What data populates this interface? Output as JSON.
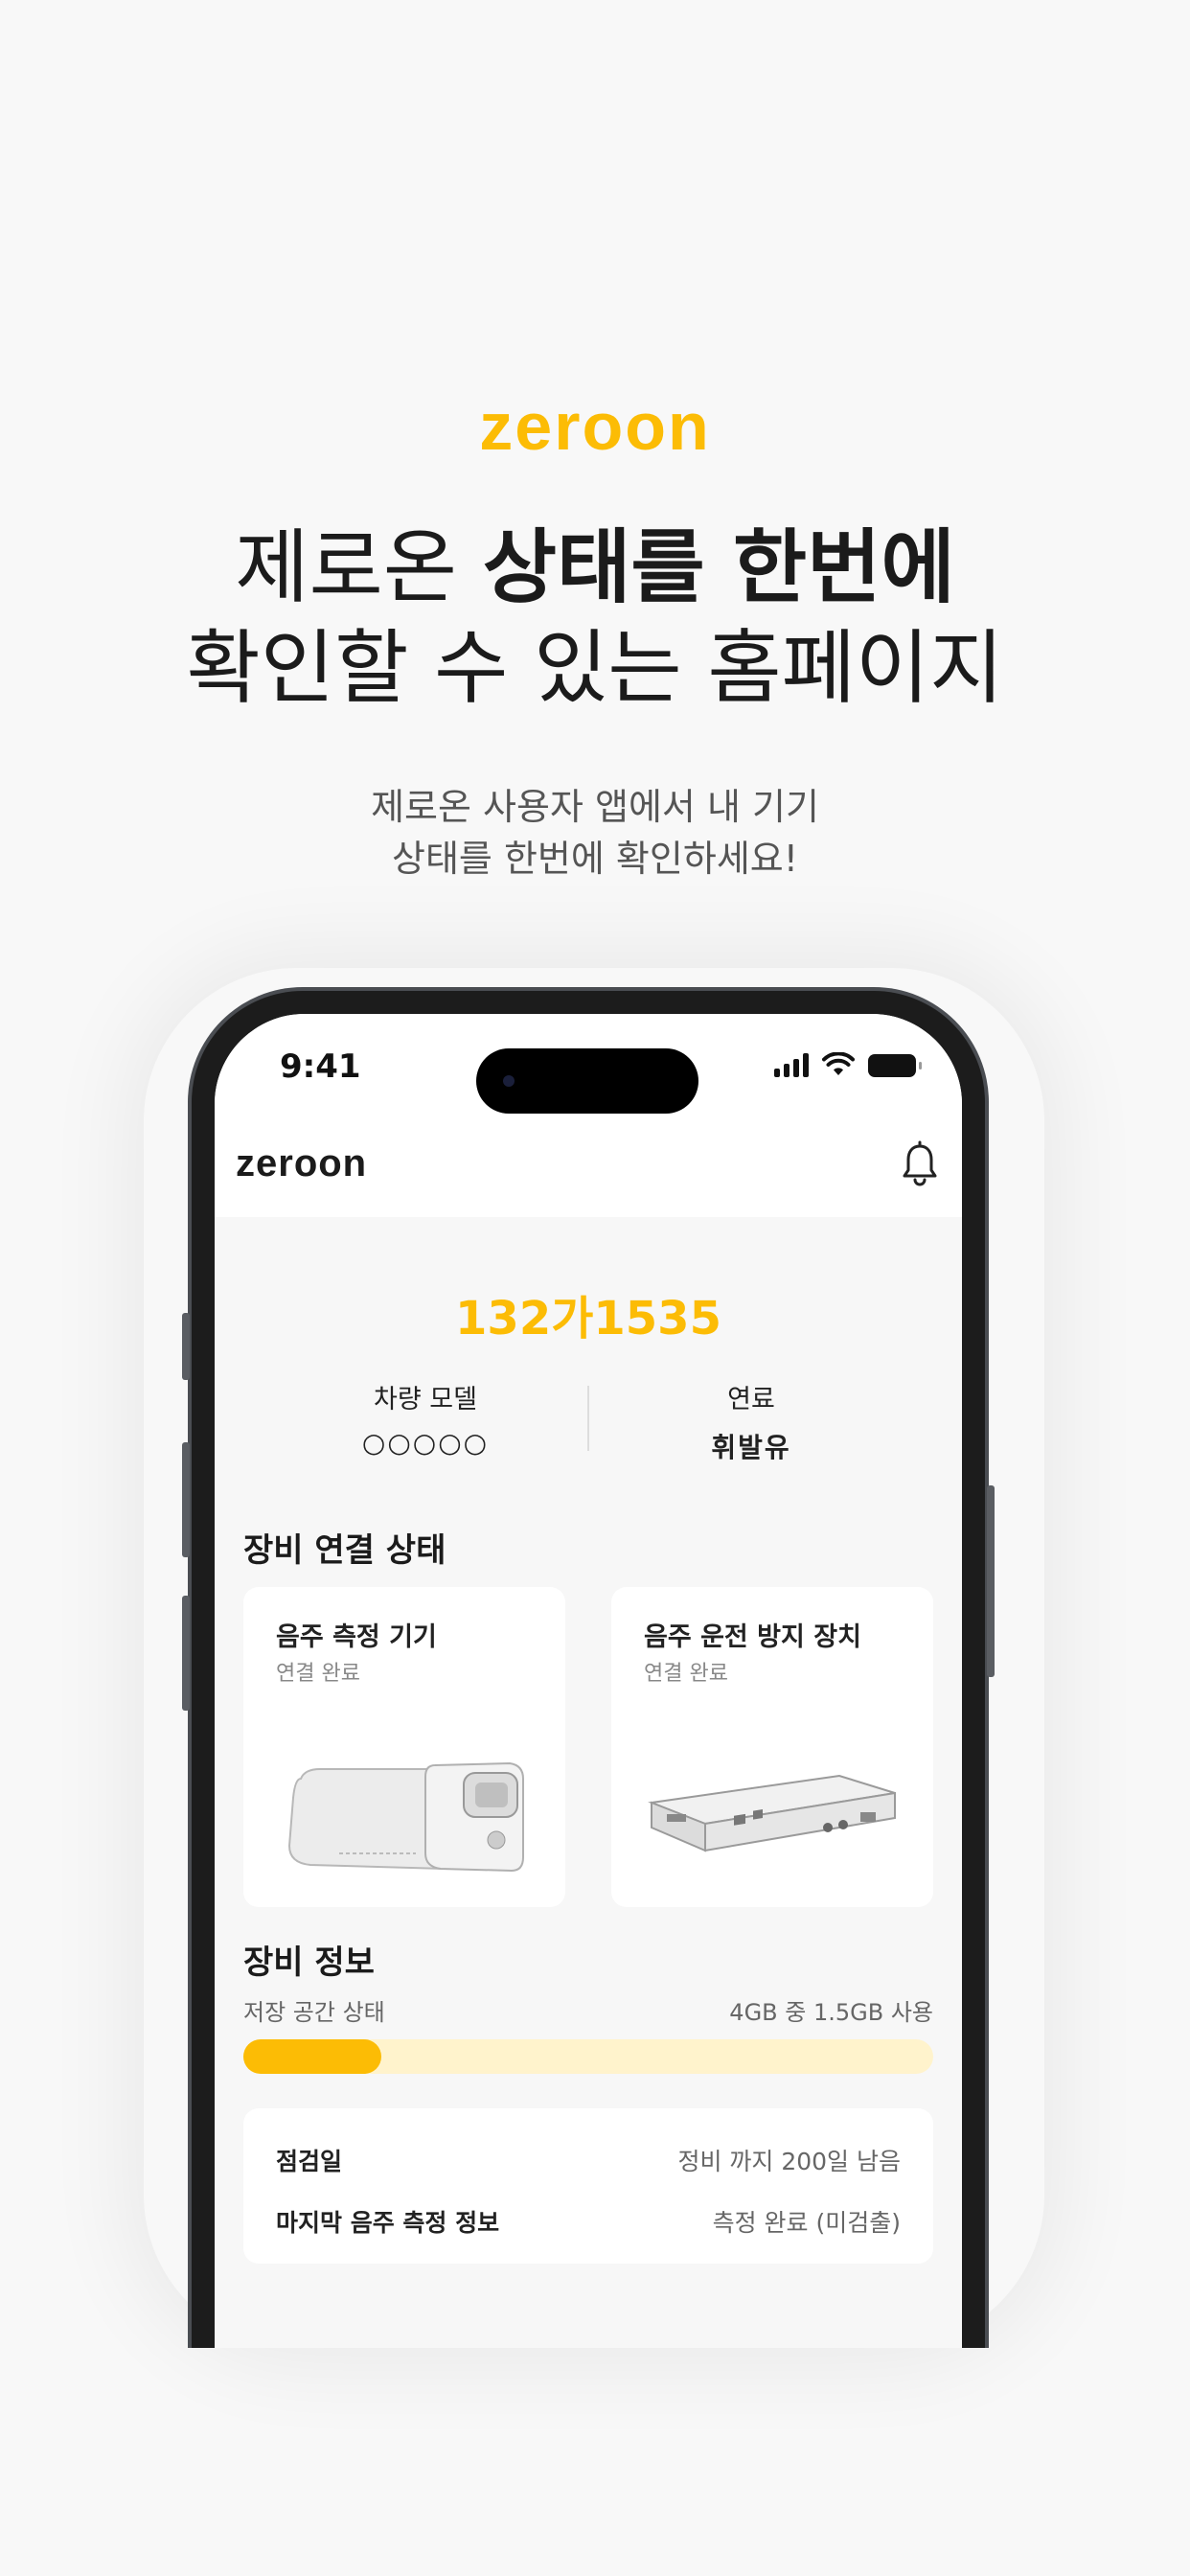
{
  "promo": {
    "brand": "zeroon",
    "headline_line1_regular": "제로온 ",
    "headline_line1_bold": "상태를 한번에",
    "headline_line2": "확인할 수 있는 홈페이지",
    "subtitle_line1": "제로온 사용자 앱에서 내 기기",
    "subtitle_line2": "상태를 한번에 확인하세요!"
  },
  "colors": {
    "accent": "#fcbc05",
    "accent_light": "#fff3cc",
    "background": "#f8f8f8"
  },
  "phone": {
    "status_bar": {
      "time": "9:41",
      "icons": [
        "signal-icon",
        "wifi-icon",
        "battery-icon"
      ]
    },
    "app_bar": {
      "logo": "zeroon",
      "notification_icon": "bell-icon"
    },
    "vehicle": {
      "plate": "132가1535",
      "model_label": "차량 모델",
      "model_value": "○○○○○",
      "fuel_label": "연료",
      "fuel_value": "휘발유"
    },
    "connection": {
      "title": "장비 연결 상태",
      "devices": [
        {
          "name": "음주 측정 기기",
          "status": "연결 완료",
          "icon": "breathalyzer-device-image"
        },
        {
          "name": "음주 운전 방지 장치",
          "status": "연결 완료",
          "icon": "interlock-device-image"
        }
      ]
    },
    "device_info": {
      "title": "장비 정보",
      "storage_label": "저장 공간 상태",
      "storage_value": "4GB 중 1.5GB 사용",
      "storage_fill_fraction": 0.2,
      "rows": [
        {
          "label": "점검일",
          "value": "정비 까지 200일 남음"
        },
        {
          "label": "마지막 음주 측정 정보",
          "value": "측정 완료 (미검출)"
        }
      ]
    }
  }
}
